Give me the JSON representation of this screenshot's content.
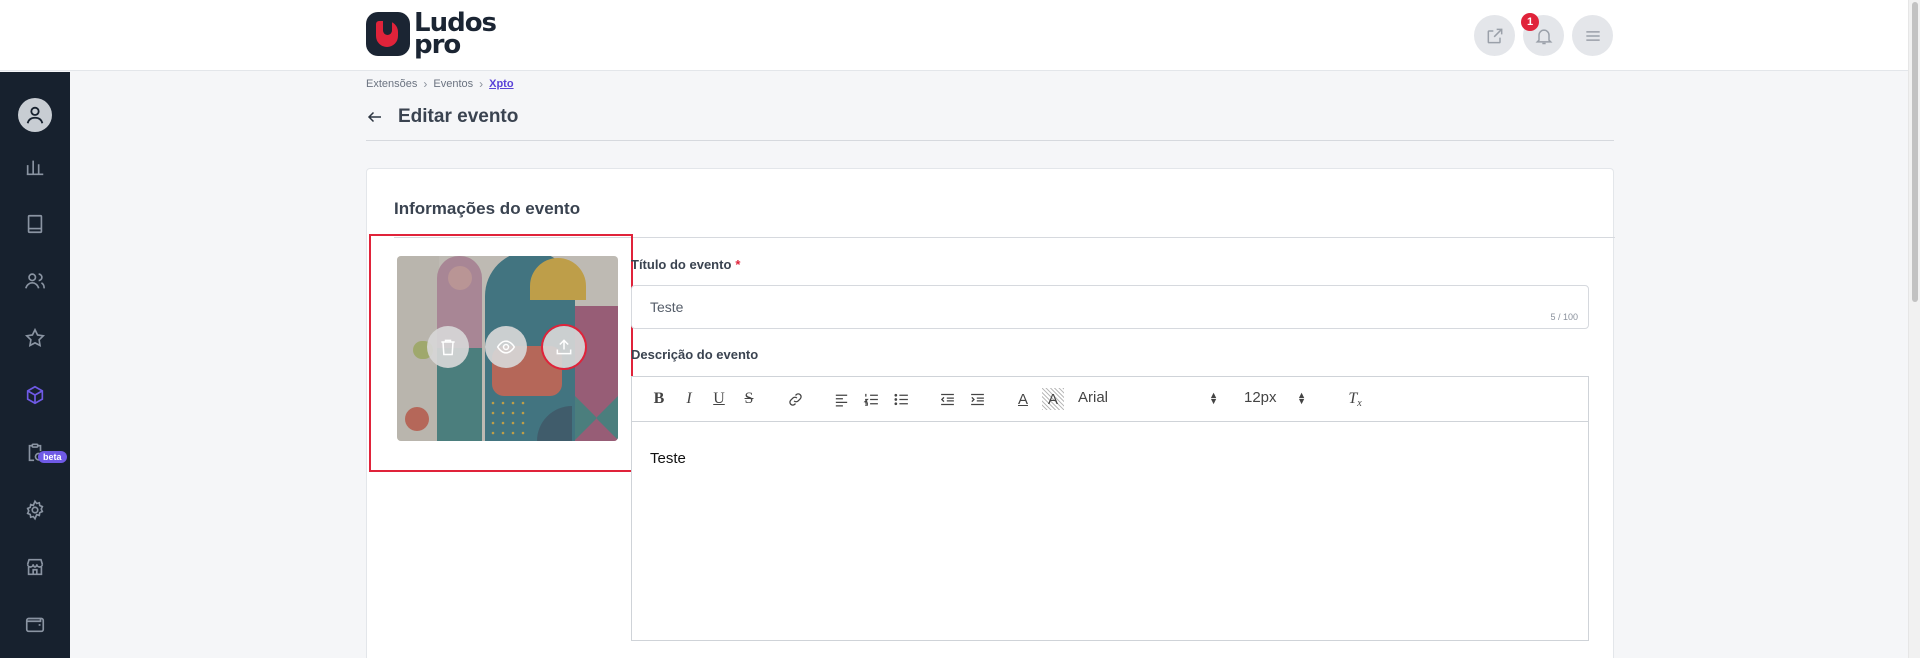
{
  "header": {
    "logo_top": "Ludos",
    "logo_bottom": "pro",
    "notification_count": "1"
  },
  "sidebar": {
    "items": [
      "dashboard",
      "book",
      "users",
      "star",
      "extensions",
      "search-clipboard",
      "settings",
      "store",
      "wallet"
    ],
    "beta_label": "beta",
    "active_item": "extensions"
  },
  "breadcrumb": [
    "Extensões",
    "Eventos",
    "Xpto"
  ],
  "page": {
    "title": "Editar evento"
  },
  "card": {
    "title": "Informações do evento",
    "title_field": {
      "label": "Título do evento",
      "required_mark": "*",
      "value": "Teste",
      "counter": "5 / 100"
    },
    "description_field": {
      "label": "Descrição do evento",
      "font": "Arial",
      "font_size": "12px",
      "content": "Teste"
    }
  },
  "colors": {
    "accent": "#6f5ae6",
    "brand_red": "#e0233a",
    "sidebar_bg": "#17212e"
  }
}
